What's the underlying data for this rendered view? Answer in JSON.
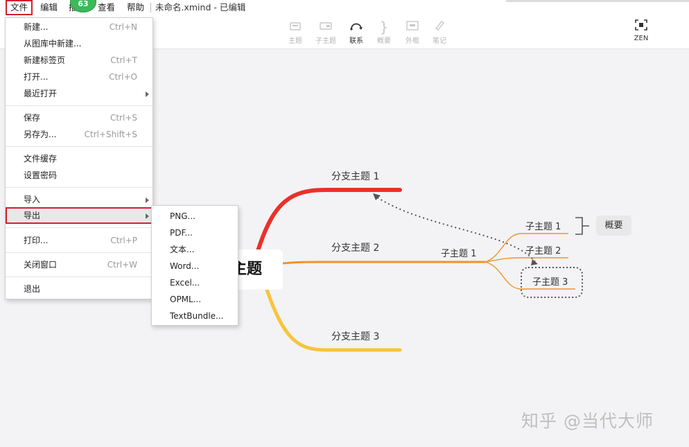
{
  "menubar": {
    "file": "文件",
    "edit": "编辑",
    "insert_partial": "插",
    "view": "查看",
    "help": "帮助",
    "badge": "63",
    "document_title": "未命名.xmind - 已编辑"
  },
  "toolbar": {
    "topic": "主题",
    "subtopic": "子主题",
    "relationship": "联系",
    "summary": "概要",
    "boundary": "外框",
    "note": "笔记",
    "zen": "ZEN"
  },
  "file_menu": {
    "new": {
      "label": "新建...",
      "shortcut": "Ctrl+N"
    },
    "new_from_library": {
      "label": "从图库中新建..."
    },
    "new_tab": {
      "label": "新建标签页",
      "shortcut": "Ctrl+T"
    },
    "open": {
      "label": "打开...",
      "shortcut": "Ctrl+O"
    },
    "recent": {
      "label": "最近打开"
    },
    "save": {
      "label": "保存",
      "shortcut": "Ctrl+S"
    },
    "save_as": {
      "label": "另存为...",
      "shortcut": "Ctrl+Shift+S"
    },
    "file_cache": {
      "label": "文件缓存"
    },
    "set_password": {
      "label": "设置密码"
    },
    "import": {
      "label": "导入"
    },
    "export": {
      "label": "导出"
    },
    "print": {
      "label": "打印...",
      "shortcut": "Ctrl+P"
    },
    "close_window": {
      "label": "关闭窗口",
      "shortcut": "Ctrl+W"
    },
    "quit": {
      "label": "退出"
    }
  },
  "export_submenu": [
    "PNG...",
    "PDF...",
    "文本...",
    "Word...",
    "Excel...",
    "OPML...",
    "TextBundle..."
  ],
  "mindmap": {
    "central_topic": "主题",
    "branch1": "分支主题 1",
    "branch2": "分支主题 2",
    "branch3": "分支主题 3",
    "branch2_sub": "子主题 1",
    "sub1": "子主题 1",
    "sub2": "子主题 2",
    "sub3": "子主题 3",
    "summary": "概要"
  },
  "colors": {
    "branch1": "#e8322a",
    "branch2": "#f0932b",
    "branch3": "#f9c43a",
    "highlight": "#d4202a"
  },
  "watermark": "知乎 @当代大师"
}
